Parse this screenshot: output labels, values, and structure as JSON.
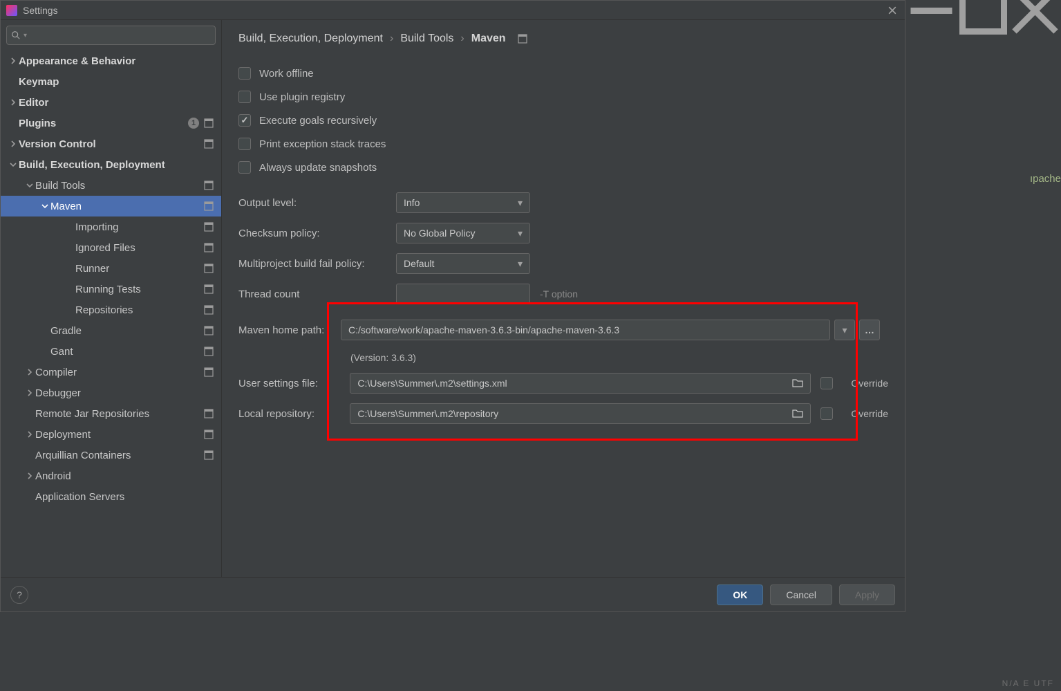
{
  "window": {
    "title": "Settings",
    "partial_text_right": "ıpache"
  },
  "sidebar": {
    "search_placeholder": "",
    "items": [
      {
        "label": "Appearance & Behavior",
        "bold": true,
        "arrow": "right",
        "proj": false,
        "badge": null,
        "indent": 0
      },
      {
        "label": "Keymap",
        "bold": true,
        "arrow": "",
        "proj": false,
        "badge": null,
        "indent": 0
      },
      {
        "label": "Editor",
        "bold": true,
        "arrow": "right",
        "proj": false,
        "badge": null,
        "indent": 0
      },
      {
        "label": "Plugins",
        "bold": true,
        "arrow": "",
        "proj": true,
        "badge": "1",
        "indent": 0
      },
      {
        "label": "Version Control",
        "bold": true,
        "arrow": "right",
        "proj": true,
        "badge": null,
        "indent": 0
      },
      {
        "label": "Build, Execution, Deployment",
        "bold": true,
        "arrow": "down",
        "proj": false,
        "badge": null,
        "indent": 0
      },
      {
        "label": "Build Tools",
        "bold": false,
        "arrow": "down",
        "proj": true,
        "badge": null,
        "indent": 1
      },
      {
        "label": "Maven",
        "bold": false,
        "arrow": "down",
        "proj": true,
        "badge": null,
        "indent": 2,
        "selected": true
      },
      {
        "label": "Importing",
        "bold": false,
        "arrow": "",
        "proj": true,
        "badge": null,
        "indent": 3
      },
      {
        "label": "Ignored Files",
        "bold": false,
        "arrow": "",
        "proj": true,
        "badge": null,
        "indent": 3
      },
      {
        "label": "Runner",
        "bold": false,
        "arrow": "",
        "proj": true,
        "badge": null,
        "indent": 3
      },
      {
        "label": "Running Tests",
        "bold": false,
        "arrow": "",
        "proj": true,
        "badge": null,
        "indent": 3
      },
      {
        "label": "Repositories",
        "bold": false,
        "arrow": "",
        "proj": true,
        "badge": null,
        "indent": 3
      },
      {
        "label": "Gradle",
        "bold": false,
        "arrow": "",
        "proj": true,
        "badge": null,
        "indent": 2
      },
      {
        "label": "Gant",
        "bold": false,
        "arrow": "",
        "proj": true,
        "badge": null,
        "indent": 2
      },
      {
        "label": "Compiler",
        "bold": false,
        "arrow": "right",
        "proj": true,
        "badge": null,
        "indent": 1
      },
      {
        "label": "Debugger",
        "bold": false,
        "arrow": "right",
        "proj": false,
        "badge": null,
        "indent": 1
      },
      {
        "label": "Remote Jar Repositories",
        "bold": false,
        "arrow": "",
        "proj": true,
        "badge": null,
        "indent": 1
      },
      {
        "label": "Deployment",
        "bold": false,
        "arrow": "right",
        "proj": true,
        "badge": null,
        "indent": 1
      },
      {
        "label": "Arquillian Containers",
        "bold": false,
        "arrow": "",
        "proj": true,
        "badge": null,
        "indent": 1
      },
      {
        "label": "Android",
        "bold": false,
        "arrow": "right",
        "proj": false,
        "badge": null,
        "indent": 1
      },
      {
        "label": "Application Servers",
        "bold": false,
        "arrow": "",
        "proj": false,
        "badge": null,
        "indent": 1
      }
    ]
  },
  "breadcrumb": {
    "seg1": "Build, Execution, Deployment",
    "seg2": "Build Tools",
    "seg3": "Maven"
  },
  "checkboxes": {
    "work_offline": "Work offline",
    "use_plugin_registry": "Use plugin registry",
    "execute_goals": "Execute goals recursively",
    "print_exception": "Print exception stack traces",
    "always_update": "Always update snapshots"
  },
  "form": {
    "output_level_label": "Output level:",
    "output_level_value": "Info",
    "checksum_label": "Checksum policy:",
    "checksum_value": "No Global Policy",
    "multiproject_label": "Multiproject build fail policy:",
    "multiproject_value": "Default",
    "thread_count_label": "Thread count",
    "thread_count_value": "",
    "thread_count_note": "-T option",
    "maven_home_label": "Maven home path:",
    "maven_home_value": "C:/software/work/apache-maven-3.6.3-bin/apache-maven-3.6.3",
    "version_note": "(Version: 3.6.3)",
    "user_settings_label": "User settings file:",
    "user_settings_value": "C:\\Users\\Summer\\.m2\\settings.xml",
    "local_repo_label": "Local repository:",
    "local_repo_value": "C:\\Users\\Summer\\.m2\\repository",
    "override_label": "Override"
  },
  "footer": {
    "ok": "OK",
    "cancel": "Cancel",
    "apply": "Apply"
  }
}
